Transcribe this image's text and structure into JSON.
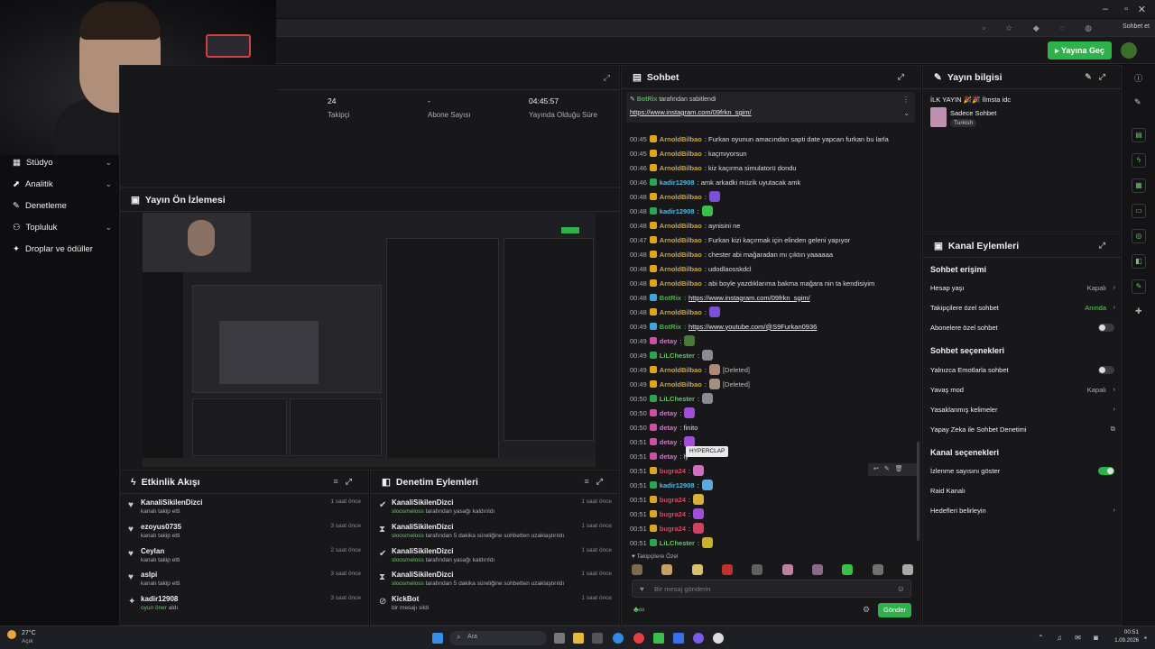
{
  "top_bar": {
    "go_live_label": "Yayına Geç",
    "user_label": "Sohbet et"
  },
  "sidebar": {
    "items": [
      {
        "label": "Stüdyo",
        "has_chevron": true
      },
      {
        "label": "Analitik",
        "has_chevron": true
      },
      {
        "label": "Denetleme",
        "has_chevron": false
      },
      {
        "label": "Topluluk",
        "has_chevron": true
      },
      {
        "label": "Droplar ve ödüller",
        "has_chevron": false
      }
    ]
  },
  "stats": [
    {
      "value": "24",
      "label": "Takipçi"
    },
    {
      "value": "-",
      "label": "Abone Sayısı"
    },
    {
      "value": "04:45:57",
      "label": "Yayında Olduğu Süre"
    }
  ],
  "preview": {
    "title": "Yayın Ön İzlemesi"
  },
  "activity_feed": {
    "title": "Etkinlik Akışı",
    "items": [
      {
        "icon": "heart-icon",
        "name": "KanaliSikilenDizci",
        "sub": "kanalı takip etti",
        "time": "1 saat önce"
      },
      {
        "icon": "heart-icon",
        "name": "ezoyus0735",
        "sub": "kanalı takip etti",
        "time": "3 saat önce"
      },
      {
        "icon": "heart-icon",
        "name": "Ceylan",
        "sub": "kanalı takip etti",
        "time": "2 saat önce"
      },
      {
        "icon": "heart-icon",
        "name": "aslpi",
        "sub": "kanalı takip etti",
        "time": "3 saat önce"
      },
      {
        "icon": "gift-icon",
        "name": "kadir12908",
        "sub_green": "oyun öner",
        "sub": " aldı",
        "time": "3 saat önce"
      }
    ]
  },
  "moderation": {
    "title": "Denetim Eylemleri",
    "items": [
      {
        "icon": "check-icon",
        "name": "KanaliSikilenDizci",
        "actor": "sloosmeloss",
        "sub": " tarafından yasağı kaldırıldı",
        "time": "1 saat önce"
      },
      {
        "icon": "hourglass-icon",
        "name": "KanaliSikilenDizci",
        "actor": "sloosmeloss",
        "sub": " tarafından 5 dakika süreliğine sohbetten uzaklaştırıldı",
        "time": "1 saat önce"
      },
      {
        "icon": "check-icon",
        "name": "KanaliSikilenDizci",
        "actor": "sloosmeloss",
        "sub": " tarafından yasağı kaldırıldı",
        "time": "1 saat önce"
      },
      {
        "icon": "hourglass-icon",
        "name": "KanaliSikilenDizci",
        "actor": "sloosmeloss",
        "sub": " tarafından 5 dakika süreliğine sohbetten uzaklaştırıldı",
        "time": "1 saat önce"
      },
      {
        "icon": "ban-icon",
        "name": "KickBot",
        "actor": "",
        "sub": "bir mesajı sildi",
        "time": "1 saat önce"
      }
    ]
  },
  "chat": {
    "title": "Sohbet",
    "pinned": {
      "author": "BotRix",
      "note": "tarafından sabitlendi",
      "link": "https://www.instagram.com/09frkn_sgim/"
    },
    "messages": [
      {
        "time": "00:45",
        "user": "ArnoldBilbao",
        "cls": "u-arnold",
        "badge": "",
        "text": ": Furkan oyunun amacından sapti date yapcan furkan bu larla"
      },
      {
        "time": "00:45",
        "user": "ArnoldBilbao",
        "cls": "u-arnold",
        "badge": "",
        "text": ": kaçmıyorsun"
      },
      {
        "time": "00:46",
        "user": "ArnoldBilbao",
        "cls": "u-arnold",
        "badge": "",
        "text": ": kiz kaçırma simulatorü dondu"
      },
      {
        "time": "00:46",
        "user": "kadir12908",
        "cls": "u-kadir",
        "badge": "mod",
        "text": ": amk arkadki müzik uyutacak amk"
      },
      {
        "time": "00:48",
        "user": "ArnoldBilbao",
        "cls": "u-arnold",
        "badge": "",
        "text": ":",
        "emote": "#7b4fd8"
      },
      {
        "time": "00:48",
        "user": "kadir12908",
        "cls": "u-kadir",
        "badge": "mod",
        "text": ":",
        "emote": "#3cbf4a"
      },
      {
        "time": "00:48",
        "user": "ArnoldBilbao",
        "cls": "u-arnold",
        "badge": "",
        "text": ": aynisini ne"
      },
      {
        "time": "00:47",
        "user": "ArnoldBilbao",
        "cls": "u-arnold",
        "badge": "",
        "text": ": Furkan kizi kaçırmak için elinden geleni yapıyor"
      },
      {
        "time": "00:48",
        "user": "ArnoldBilbao",
        "cls": "u-arnold",
        "badge": "",
        "text": ": chester abi mağaradan mı çıktın yaaaaaa"
      },
      {
        "time": "00:48",
        "user": "ArnoldBilbao",
        "cls": "u-arnold",
        "badge": "",
        "text": ": udodlaosskdcl"
      },
      {
        "time": "00:48",
        "user": "ArnoldBilbao",
        "cls": "u-arnold",
        "badge": "",
        "text": ": abi boyle yazdıklarıma bakma mağara nin ta kendisiyim"
      },
      {
        "time": "00:48",
        "user": "BotRix",
        "cls": "u-botrix",
        "badge": "bot",
        "text": ": ",
        "link": "https://www.instagram.com/09frkn_sgim/"
      },
      {
        "time": "00:48",
        "user": "ArnoldBilbao",
        "cls": "u-arnold",
        "badge": "",
        "text": ":",
        "emote": "#7b4fd8"
      },
      {
        "time": "00:49",
        "user": "BotRix",
        "cls": "u-botrix",
        "badge": "bot",
        "text": ": ",
        "link": "https://www.youtube.com/@S9Furkan0936"
      },
      {
        "time": "00:49",
        "user": "detay",
        "cls": "u-detay",
        "badge": "vip",
        "text": ":",
        "emote": "#4a7a3a"
      },
      {
        "time": "00:49",
        "user": "LiLChester",
        "cls": "u-lil",
        "badge": "mod",
        "text": ":",
        "emote": "#8a8a90"
      },
      {
        "time": "00:49",
        "user": "ArnoldBilbao",
        "cls": "u-arnold",
        "badge": "",
        "text": ":",
        "emote": "#b08878",
        "extra": "[Deleted]"
      },
      {
        "time": "00:49",
        "user": "ArnoldBilbao",
        "cls": "u-arnold",
        "badge": "",
        "text": ":",
        "emote": "#a09080",
        "extra": "[Deleted]"
      },
      {
        "time": "00:50",
        "user": "LiLChester",
        "cls": "u-lil",
        "badge": "mod",
        "text": ":",
        "emote": "#8a8a90"
      },
      {
        "time": "00:50",
        "user": "detay",
        "cls": "u-detay",
        "badge": "vip",
        "text": ":",
        "emote": "#a04fd8"
      },
      {
        "time": "00:50",
        "user": "detay",
        "cls": "u-detay",
        "badge": "vip",
        "text": ": finito"
      },
      {
        "time": "00:51",
        "user": "detay",
        "cls": "u-detay",
        "badge": "vip",
        "text": ":",
        "emote": "#a04fd8"
      },
      {
        "time": "00:51",
        "user": "detay",
        "cls": "u-detay",
        "badge": "vip",
        "text": ": ly"
      },
      {
        "time": "00:51",
        "user": "bugra24",
        "cls": "u-bugra",
        "badge": "",
        "text": ":",
        "emote": "#d070c0"
      },
      {
        "time": "00:51",
        "user": "kadir12908",
        "cls": "u-kadir",
        "badge": "mod",
        "text": ":",
        "emote": "#5ea8e0"
      },
      {
        "time": "00:51",
        "user": "bugra24",
        "cls": "u-bugra",
        "badge": "",
        "text": ":",
        "emote": "#d8b040"
      },
      {
        "time": "00:51",
        "user": "bugra24",
        "cls": "u-bugra",
        "badge": "",
        "text": ":",
        "emote": "#a04fd8"
      },
      {
        "time": "00:51",
        "user": "bugra24",
        "cls": "u-bugra",
        "badge": "",
        "text": ":",
        "emote": "#d04060"
      },
      {
        "time": "00:51",
        "user": "LiLChester",
        "cls": "u-lil",
        "badge": "mod",
        "text": ":",
        "emote": "#c8b030"
      }
    ],
    "tooltip": "HYPERCLAP",
    "followers_only_label": "Takipçilere Özel",
    "input_placeholder": "Bir mesaj gönderin",
    "send_label": "Gönder"
  },
  "stream_info": {
    "title": "Yayın bilgisi",
    "stream_title": "İLK YAYIN 🎉🎉 İlmsta idc",
    "category": "Sadece Sohbet",
    "language_tag": "Turkish"
  },
  "channel_actions": {
    "title": "Kanal Eylemleri",
    "chat_access_heading": "Sohbet erişimi",
    "chat_access": [
      {
        "label": "Hesap yaşı",
        "value": "Kapalı",
        "control": "chevron"
      },
      {
        "label": "Takipçilere özel sohbet",
        "value": "Anında",
        "control": "chevron",
        "green": true
      },
      {
        "label": "Abonelere özel sohbet",
        "value": "",
        "control": "toggle-off"
      }
    ],
    "chat_options_heading": "Sohbet seçenekleri",
    "chat_options": [
      {
        "label": "Yalnızca Emotlarla sohbet",
        "value": "",
        "control": "toggle-off"
      },
      {
        "label": "Yavaş mod",
        "value": "Kapalı",
        "control": "chevron"
      },
      {
        "label": "Yasaklanmış kelimeler",
        "value": "",
        "control": "chevron"
      },
      {
        "label": "Yapay Zeka ile Sohbet Denetimi",
        "value": "",
        "control": "external"
      }
    ],
    "channel_options_heading": "Kanal seçenekleri",
    "channel_options": [
      {
        "label": "İzlenme sayısını göster",
        "value": "",
        "control": "toggle-on"
      },
      {
        "label": "Raid Kanalı",
        "value": "",
        "control": "none"
      },
      {
        "label": "Hedefleri belirleyin",
        "value": "",
        "control": "chevron"
      }
    ]
  },
  "taskbar": {
    "weather_temp": "27°C",
    "weather_desc": "Açık",
    "search_placeholder": "Ara",
    "clock_time": "00:51",
    "clock_date": "1.09.2026"
  }
}
